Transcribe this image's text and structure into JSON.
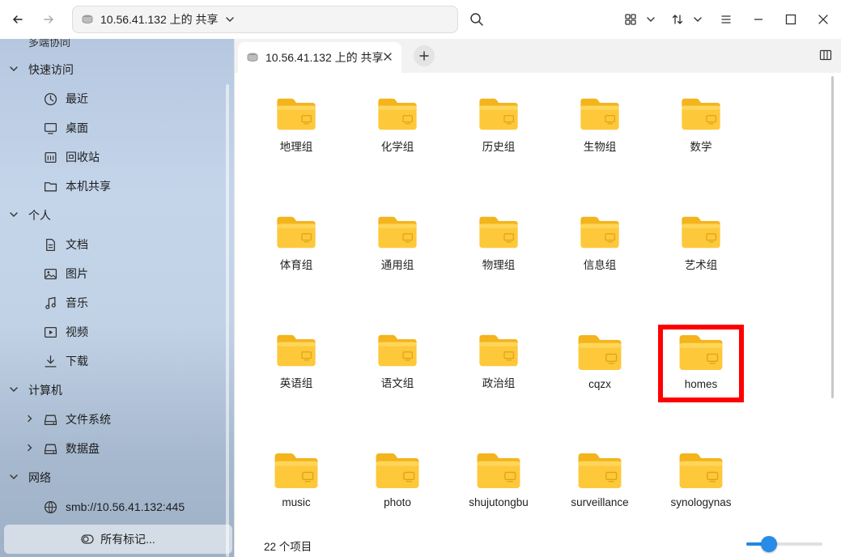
{
  "window": {
    "address": "10.56.41.132 上的 共享"
  },
  "sidebar": {
    "cut_label": "多端协同",
    "sections": [
      {
        "label": "快速访问",
        "items": [
          "最近",
          "桌面",
          "回收站",
          "本机共享"
        ]
      },
      {
        "label": "个人",
        "items": [
          "文档",
          "图片",
          "音乐",
          "视频",
          "下载"
        ]
      },
      {
        "label": "计算机",
        "items": [
          "文件系统",
          "数据盘"
        ]
      },
      {
        "label": "网络",
        "items": [
          "smb://10.56.41.132:445"
        ]
      }
    ],
    "tags_button": "所有标记..."
  },
  "tabs": [
    {
      "label": "10.56.41.132 上的 共享"
    }
  ],
  "folders": [
    "地理组",
    "化学组",
    "历史组",
    "生物组",
    "数学",
    "体育组",
    "通用组",
    "物理组",
    "信息组",
    "艺术组",
    "英语组",
    "语文组",
    "政治组",
    "cqzx",
    "homes",
    "music",
    "photo",
    "shujutongbu",
    "surveillance",
    "synologynas"
  ],
  "status": {
    "count": "22 个项目"
  },
  "zoom": {
    "fraction": 0.3
  },
  "colors": {
    "accent": "#1e88e5",
    "folder": "#fdc83a",
    "highlight": "#ff0000"
  }
}
